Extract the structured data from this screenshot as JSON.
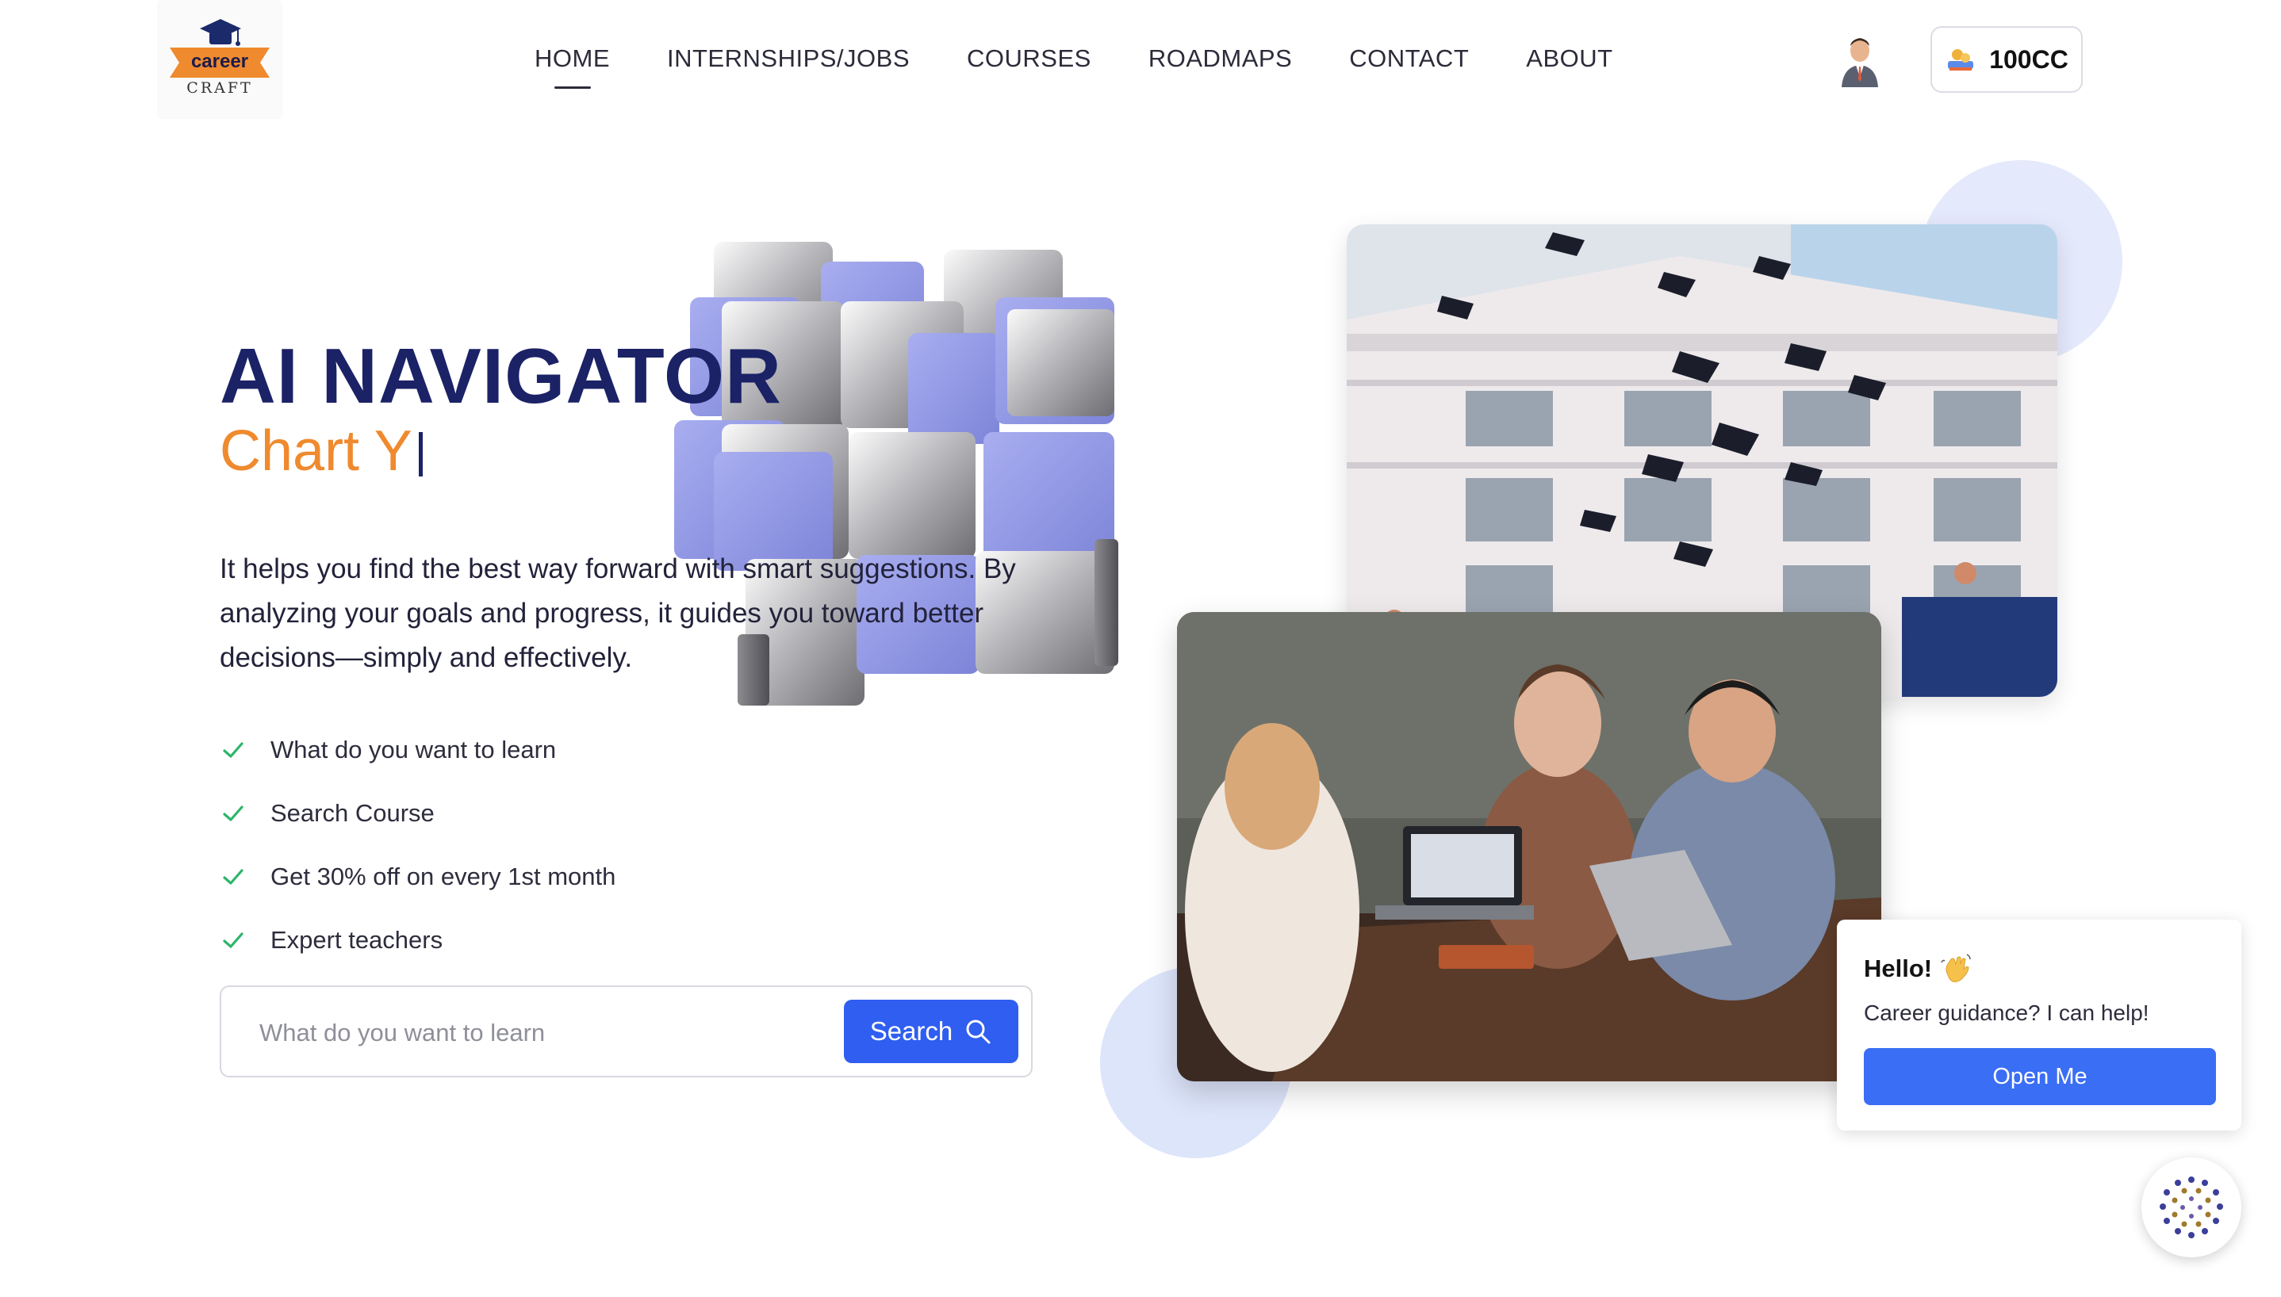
{
  "brand": {
    "line1": "career",
    "line2": "CRAFT",
    "logo_icon": "graduation-cap-icon",
    "accent": "#ef8a2e"
  },
  "nav": {
    "items": [
      {
        "label": "HOME",
        "active": true
      },
      {
        "label": "INTERNSHIPS/JOBS",
        "active": false
      },
      {
        "label": "COURSES",
        "active": false
      },
      {
        "label": "ROADMAPS",
        "active": false
      },
      {
        "label": "CONTACT",
        "active": false
      },
      {
        "label": "ABOUT",
        "active": false
      }
    ]
  },
  "account": {
    "avatar_icon": "user-avatar-icon",
    "coins_label": "100CC",
    "coins_icon": "coin-icon"
  },
  "hero": {
    "title": "AI NAVIGATOR",
    "typed_text": "Chart Y",
    "description": "It helps you find the best way forward with smart suggestions. By analyzing your goals and progress, it guides you toward better decisions—simply and effectively.",
    "features": [
      "What do you want to learn",
      "Search Course",
      "Get 30% off on every 1st month",
      "Expert teachers"
    ],
    "check_icon": "check-icon",
    "title_color": "#1b2266",
    "subtitle_color": "#ef8a2e"
  },
  "search": {
    "placeholder": "What do you want to learn",
    "button_label": "Search",
    "button_icon": "search-icon",
    "button_color": "#2f5ef0"
  },
  "images": {
    "graduation": "graduation-photo",
    "study": "students-studying-photo"
  },
  "chat": {
    "greeting": "Hello!",
    "greeting_icon": "waving-hand-icon",
    "message": "Career guidance? I can help!",
    "button_label": "Open Me",
    "launcher_icon": "chatbot-icon",
    "button_color": "#3a6ef5"
  }
}
